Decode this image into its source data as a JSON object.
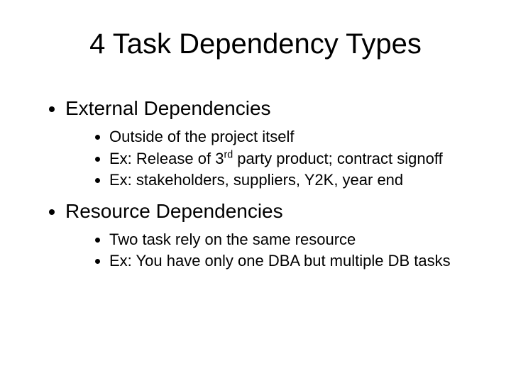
{
  "title": "4 Task Dependency Types",
  "sections": [
    {
      "heading": "External Dependencies",
      "items": [
        "Outside of the project itself",
        "Ex: Release of 3rd party product; contract signoff",
        "Ex: stakeholders, suppliers, Y2K, year end"
      ]
    },
    {
      "heading": "Resource Dependencies",
      "items": [
        "Two task rely on the same resource",
        "Ex: You have only one DBA but multiple DB tasks"
      ]
    }
  ]
}
